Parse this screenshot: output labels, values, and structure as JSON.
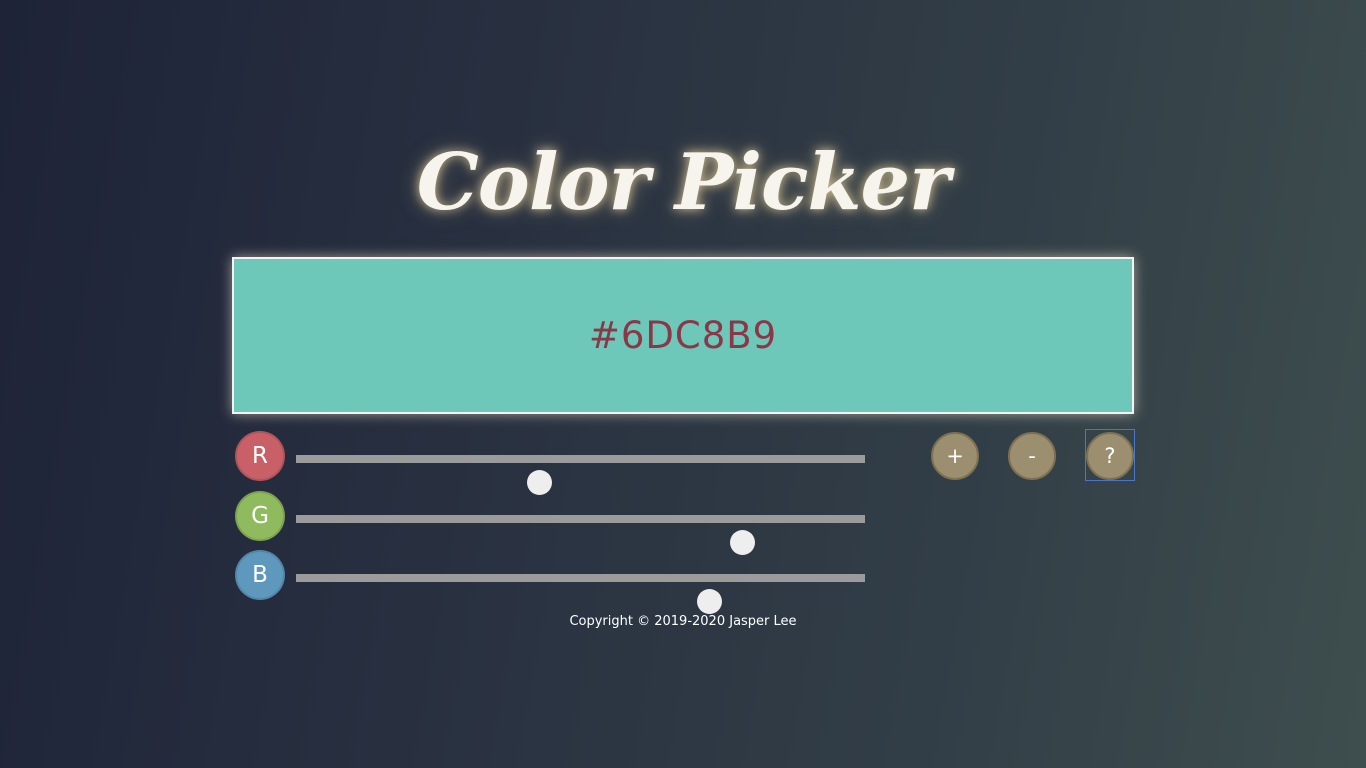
{
  "header": {
    "title": "Color Picker"
  },
  "swatch": {
    "hex": "#6DC8B9",
    "background_color": "#6DC8B9",
    "text_color": "#8B3748"
  },
  "sliders": [
    {
      "label": "R",
      "value": 109,
      "max": 255,
      "badge_color": "#c96068"
    },
    {
      "label": "G",
      "value": 200,
      "max": 255,
      "badge_color": "#8fba5e"
    },
    {
      "label": "B",
      "value": 185,
      "max": 255,
      "badge_color": "#5f98bd"
    }
  ],
  "controls": {
    "add_label": "+",
    "remove_label": "-",
    "help_label": "?"
  },
  "footer": {
    "copyright": "Copyright © 2019-2020 Jasper Lee"
  }
}
